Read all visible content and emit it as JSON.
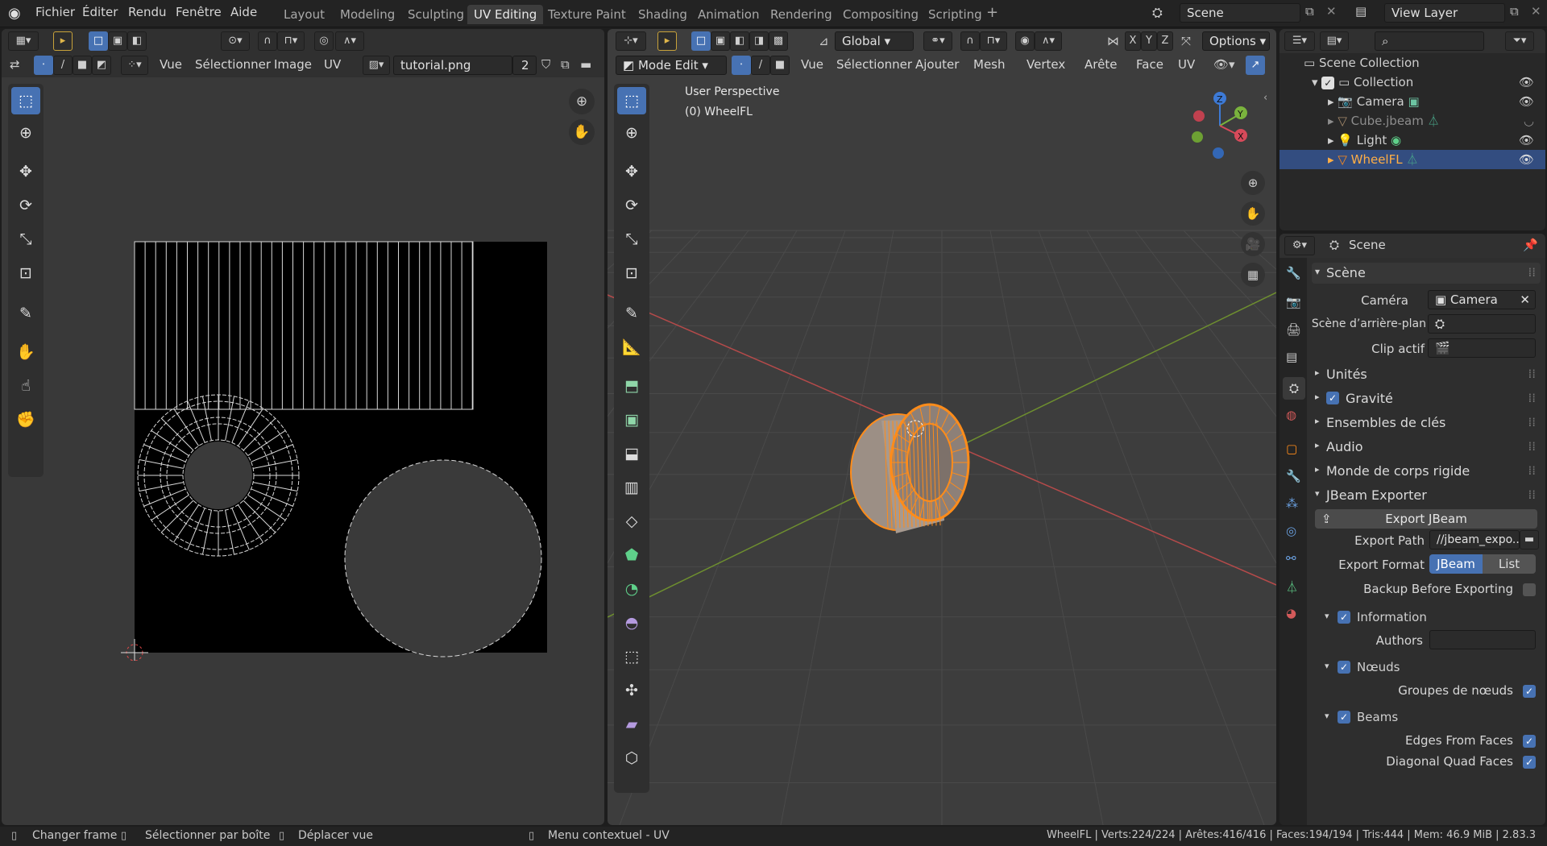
{
  "topbar": {
    "menus": [
      "Fichier",
      "Éditer",
      "Rendu",
      "Fenêtre",
      "Aide"
    ],
    "workspaces": [
      "Layout",
      "Modeling",
      "Sculpting",
      "UV Editing",
      "Texture Paint",
      "Shading",
      "Animation",
      "Rendering",
      "Compositing",
      "Scripting"
    ],
    "active_workspace": "UV Editing",
    "scene": "Scene",
    "view_layer": "View Layer"
  },
  "uv_editor": {
    "menus": [
      "Vue",
      "Sélectionner",
      "Image",
      "UV"
    ],
    "image_name": "tutorial.png",
    "image_users": "2"
  },
  "viewport": {
    "mode": "Mode Edit",
    "menus": [
      "Vue",
      "Sélectionner",
      "Ajouter",
      "Mesh",
      "Vertex",
      "Arête",
      "Face",
      "UV"
    ],
    "orientation": "Global",
    "options_label": "Options",
    "axis_toggles": [
      "X",
      "Y",
      "Z"
    ],
    "overlay_title": "User Perspective",
    "overlay_object": "(0) WheelFL",
    "gizmo_axes": [
      "Z",
      "Y",
      "X"
    ]
  },
  "outliner": {
    "root": "Scene Collection",
    "collection": "Collection",
    "items": [
      {
        "name": "Camera"
      },
      {
        "name": "Cube.jbeam"
      },
      {
        "name": "Light"
      },
      {
        "name": "WheelFL"
      }
    ]
  },
  "properties": {
    "context": "Scene",
    "scene_panel": "Scène",
    "camera_label": "Caméra",
    "camera_value": "Camera",
    "background_label": "Scène d’arrière-plan",
    "clip_label": "Clip actif",
    "panels": [
      "Unités",
      "Gravité",
      "Ensembles de clés",
      "Audio",
      "Monde de corps rigide",
      "JBeam Exporter"
    ],
    "export_button": "Export JBeam",
    "export_path_label": "Export Path",
    "export_path_value": "//jbeam_expo...",
    "export_format_label": "Export Format",
    "format_options": [
      "JBeam",
      "List"
    ],
    "backup_label": "Backup Before Exporting",
    "info_label": "Information",
    "authors_label": "Authors",
    "nodes_label": "Nœuds",
    "node_groups_label": "Groupes de nœuds",
    "beams_label": "Beams",
    "edges_from_faces_label": "Edges From Faces",
    "diag_quad_label": "Diagonal Quad Faces"
  },
  "statusbar": {
    "hint1": "Changer frame",
    "hint2": "Sélectionner par boîte",
    "hint3": "Déplacer vue",
    "hint4": "Menu contextuel - UV",
    "stats": "WheelFL | Verts:224/224 | Arêtes:416/416 | Faces:194/194 | Tris:444 | Mem: 46.9 MiB | 2.83.3"
  },
  "colors": {
    "accent": "#4772b3",
    "selection": "#ff8c1a",
    "background": "#393939"
  }
}
